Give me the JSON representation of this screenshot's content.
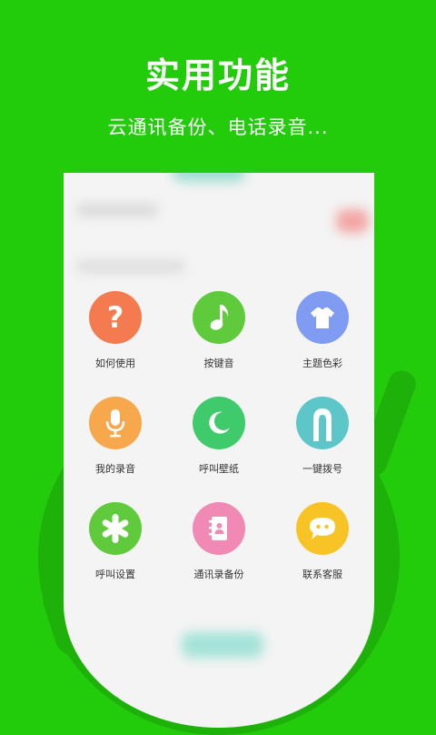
{
  "header": {
    "title": "实用功能",
    "subtitle": "云通讯备份、电话录音..."
  },
  "features": [
    {
      "label": "如何使用",
      "icon": "question-icon",
      "color": "#f47a4f"
    },
    {
      "label": "按键音",
      "icon": "music-note-icon",
      "color": "#5fca3b"
    },
    {
      "label": "主题色彩",
      "icon": "tshirt-icon",
      "color": "#7f9cf2"
    },
    {
      "label": "我的录音",
      "icon": "microphone-icon",
      "color": "#f7a84d"
    },
    {
      "label": "呼叫壁纸",
      "icon": "moon-icon",
      "color": "#3fca6b"
    },
    {
      "label": "一键拨号",
      "icon": "arch-icon",
      "color": "#5cc6c9"
    },
    {
      "label": "呼叫设置",
      "icon": "asterisk-icon",
      "color": "#5fca3b"
    },
    {
      "label": "通讯录备份",
      "icon": "contact-book-icon",
      "color": "#f08ab5"
    },
    {
      "label": "联系客服",
      "icon": "chat-bubble-icon",
      "color": "#f8c325"
    }
  ]
}
